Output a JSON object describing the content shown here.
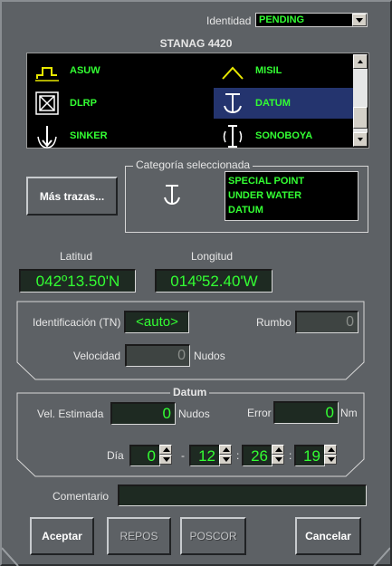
{
  "identidad": {
    "label": "Identidad",
    "value": "PENDING"
  },
  "stanag_title": "STANAG 4420",
  "symbols": [
    {
      "label": "ASUW",
      "icon": "asuw-icon"
    },
    {
      "label": "MISIL",
      "icon": "misil-icon"
    },
    {
      "label": "DLRP",
      "icon": "dlrp-icon"
    },
    {
      "label": "DATUM",
      "icon": "datum-icon",
      "selected": true
    },
    {
      "label": "SINKER",
      "icon": "sinker-icon"
    },
    {
      "label": "SONOBOYA",
      "icon": "sonoboya-icon"
    }
  ],
  "mas_trazas": "Más trazas...",
  "categoria": {
    "title": "Categoría seleccionada",
    "lines": [
      "SPECIAL POINT",
      "UNDER WATER",
      "DATUM"
    ]
  },
  "latitud": {
    "label": "Latitud",
    "value": "042º13.50'N"
  },
  "longitud": {
    "label": "Longitud",
    "value": "014º52.40'W"
  },
  "identificacion": {
    "label": "Identificación (TN)",
    "value": "<auto>"
  },
  "rumbo": {
    "label": "Rumbo",
    "value": "0"
  },
  "velocidad": {
    "label": "Velocidad",
    "value": "0",
    "unit": "Nudos"
  },
  "datum": {
    "title": "Datum",
    "vel_estimada": {
      "label": "Vel. Estimada",
      "value": "0",
      "unit": "Nudos"
    },
    "error": {
      "label": "Error",
      "value": "0",
      "unit": "Nm"
    },
    "dia": {
      "label": "Día",
      "day": "0",
      "sep1": "-",
      "hour": "12",
      "sep2": ":",
      "min": "26",
      "sep3": ":",
      "sec": "19"
    }
  },
  "comentario": {
    "label": "Comentario",
    "value": ""
  },
  "buttons": {
    "aceptar": "Aceptar",
    "repos": "REPOS",
    "poscor": "POSCOR",
    "cancelar": "Cancelar"
  },
  "colors": {
    "display_green": "#33ff33",
    "panel": "#5d6165",
    "selection": "#24346e"
  }
}
